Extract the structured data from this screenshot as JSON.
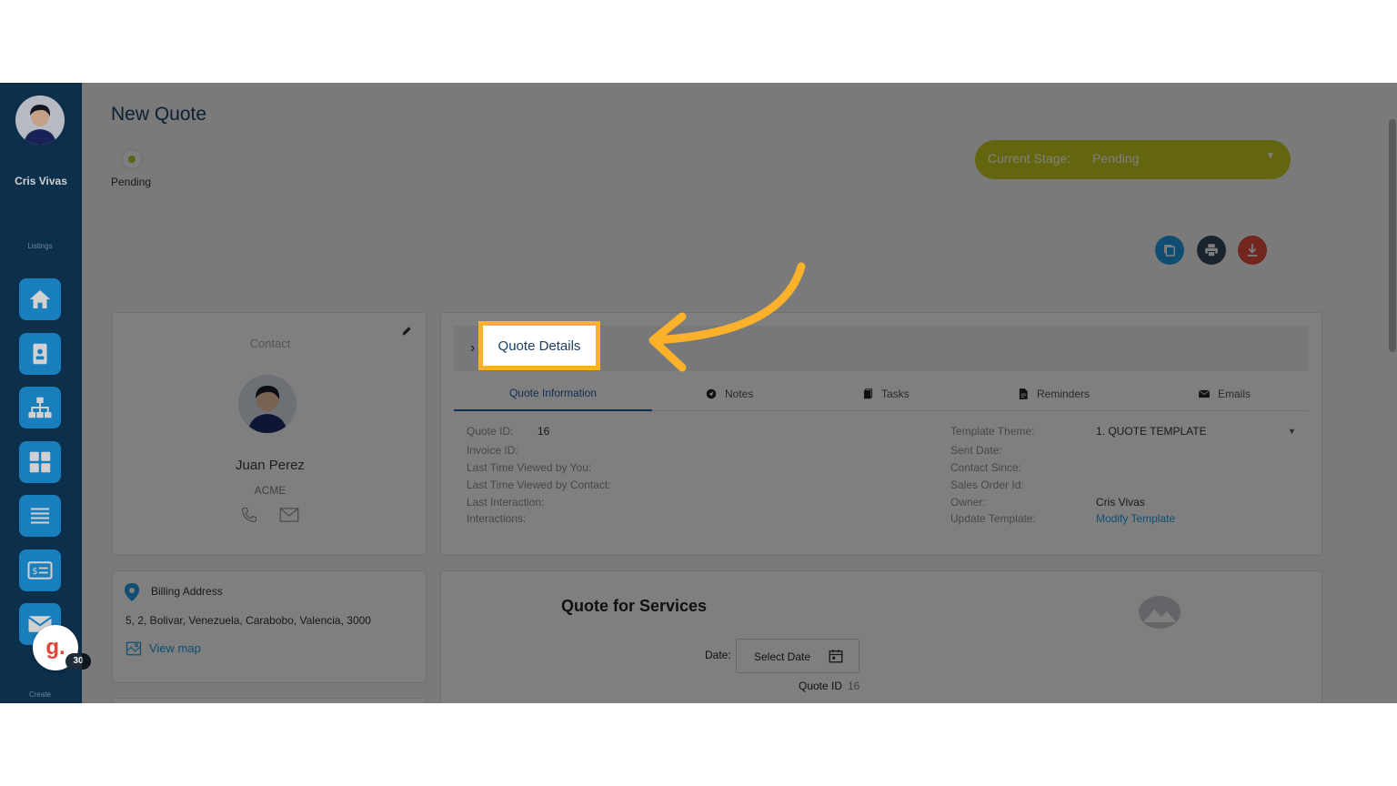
{
  "sidebar": {
    "user_name": "Cris Vivas",
    "listings_label": "Listings",
    "create_label": "Create",
    "items": [
      {
        "icon": "home-icon"
      },
      {
        "icon": "contact-card-icon"
      },
      {
        "icon": "org-chart-icon"
      },
      {
        "icon": "grid-icon"
      },
      {
        "icon": "list-icon"
      },
      {
        "icon": "invoice-icon"
      },
      {
        "icon": "mail-icon"
      }
    ],
    "widget": {
      "letter": "g.",
      "badge": "30"
    }
  },
  "header": {
    "title": "New Quote",
    "status_label": "Pending",
    "stage_label": "Current Stage:",
    "stage_value": "Pending"
  },
  "actions": [
    {
      "name": "copy-icon",
      "color": "#1f9be6"
    },
    {
      "name": "print-icon",
      "color": "#34495e"
    },
    {
      "name": "download-icon",
      "color": "#e74c3c"
    }
  ],
  "contact": {
    "title": "Contact",
    "name": "Juan Perez",
    "company": "ACME"
  },
  "quote_details": {
    "title": "Quote Details",
    "tabs": [
      {
        "label": "Quote Information",
        "icon": ""
      },
      {
        "label": "Notes",
        "icon": "notes-icon"
      },
      {
        "label": "Tasks",
        "icon": "tasks-icon"
      },
      {
        "label": "Reminders",
        "icon": "reminders-icon"
      },
      {
        "label": "Emails",
        "icon": "emails-icon"
      }
    ],
    "left_fields": [
      {
        "label": "Quote ID:",
        "value": "16"
      },
      {
        "label": "Invoice ID:",
        "value": ""
      },
      {
        "label": "Last Time Viewed by You:",
        "value": ""
      },
      {
        "label": "Last Time Viewed by Contact:",
        "value": ""
      },
      {
        "label": "Last Interaction:",
        "value": ""
      },
      {
        "label": "Interactions:",
        "value": ""
      }
    ],
    "right_fields": [
      {
        "label": "Template Theme:",
        "value": "1. QUOTE TEMPLATE"
      },
      {
        "label": "Sent Date:",
        "value": ""
      },
      {
        "label": "Contact Since:",
        "value": ""
      },
      {
        "label": "Sales Order Id:",
        "value": ""
      },
      {
        "label": "Owner:",
        "value": "Cris Vivas"
      },
      {
        "label": "Update Template:",
        "value": "Modify Template"
      }
    ]
  },
  "billing": {
    "title": "Billing Address",
    "address": "5, 2, Bolivar, Venezuela, Carabobo, Valencia, 3000",
    "map_link": "View map"
  },
  "services": {
    "title": "Quote for Services",
    "date_label": "Date:",
    "date_placeholder": "Select Date",
    "quote_id_label": "Quote ID",
    "quote_id_value": "16"
  },
  "colors": {
    "sidebar_bg": "#0f3a5c",
    "accent": "#1f9be6",
    "stage_bg": "#c6cd1e",
    "highlight": "#fbb12a"
  }
}
